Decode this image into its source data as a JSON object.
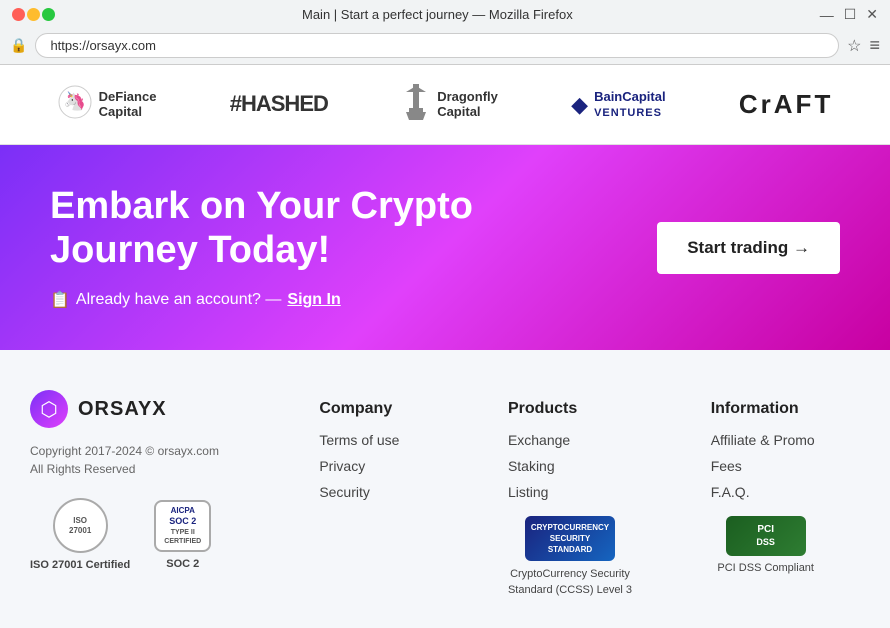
{
  "browser": {
    "title": "Main | Start a perfect journey — Mozilla Firefox",
    "url": "https://orsayx.com",
    "minimize": "—",
    "maximize": "☐",
    "close": "✕",
    "menu_icon": "≡",
    "star_icon": "☆",
    "lock_icon": "🔒"
  },
  "sponsors": [
    {
      "id": "defiance",
      "icon": "🦄",
      "name": "DeFiance\nCapital",
      "style": "icon"
    },
    {
      "id": "hashed",
      "icon": "#",
      "name": "#HASHED",
      "style": "hash"
    },
    {
      "id": "dragonfly",
      "icon": "↑",
      "name": "Dragonfly\nCapital",
      "style": "icon"
    },
    {
      "id": "bain",
      "icon": "◆",
      "name": "BainCapital\nVENTURES",
      "style": "icon"
    },
    {
      "id": "craft",
      "icon": "",
      "name": "CrAFT",
      "style": "text"
    }
  ],
  "hero": {
    "title": "Embark on Your Crypto Journey Today!",
    "signin_text": "Already have an account? —",
    "signin_link": "Sign In",
    "cta_button": "Start trading →"
  },
  "footer": {
    "logo_name": "ORSAYX",
    "copyright": "Copyright 2017-2024 © orsayx.com\nAll Rights Reserved",
    "badges": {
      "iso": {
        "label": "ISO 27001 Certified",
        "inner": "ISO\n27001"
      },
      "soc2": {
        "label": "SOC 2",
        "inner": "SOC 2\nTYPE II\nCERTIFIED"
      }
    },
    "columns": {
      "company": {
        "title": "Company",
        "links": [
          "Terms of use",
          "Privacy",
          "Security"
        ]
      },
      "products": {
        "title": "Products",
        "links": [
          "Exchange",
          "Staking",
          "Listing"
        ],
        "ccss_inner": "CRYPTOCURRENCY\nSECURITY STANDARD",
        "ccss_label": "CryptoCurrency Security\nStandard (CCSS) Level 3"
      },
      "information": {
        "title": "Information",
        "links": [
          "Affiliate & Promo",
          "Fees",
          "F.A.Q."
        ],
        "pci_inner": "PCI DSS",
        "pci_label": "PCI DSS Compliant"
      }
    }
  }
}
